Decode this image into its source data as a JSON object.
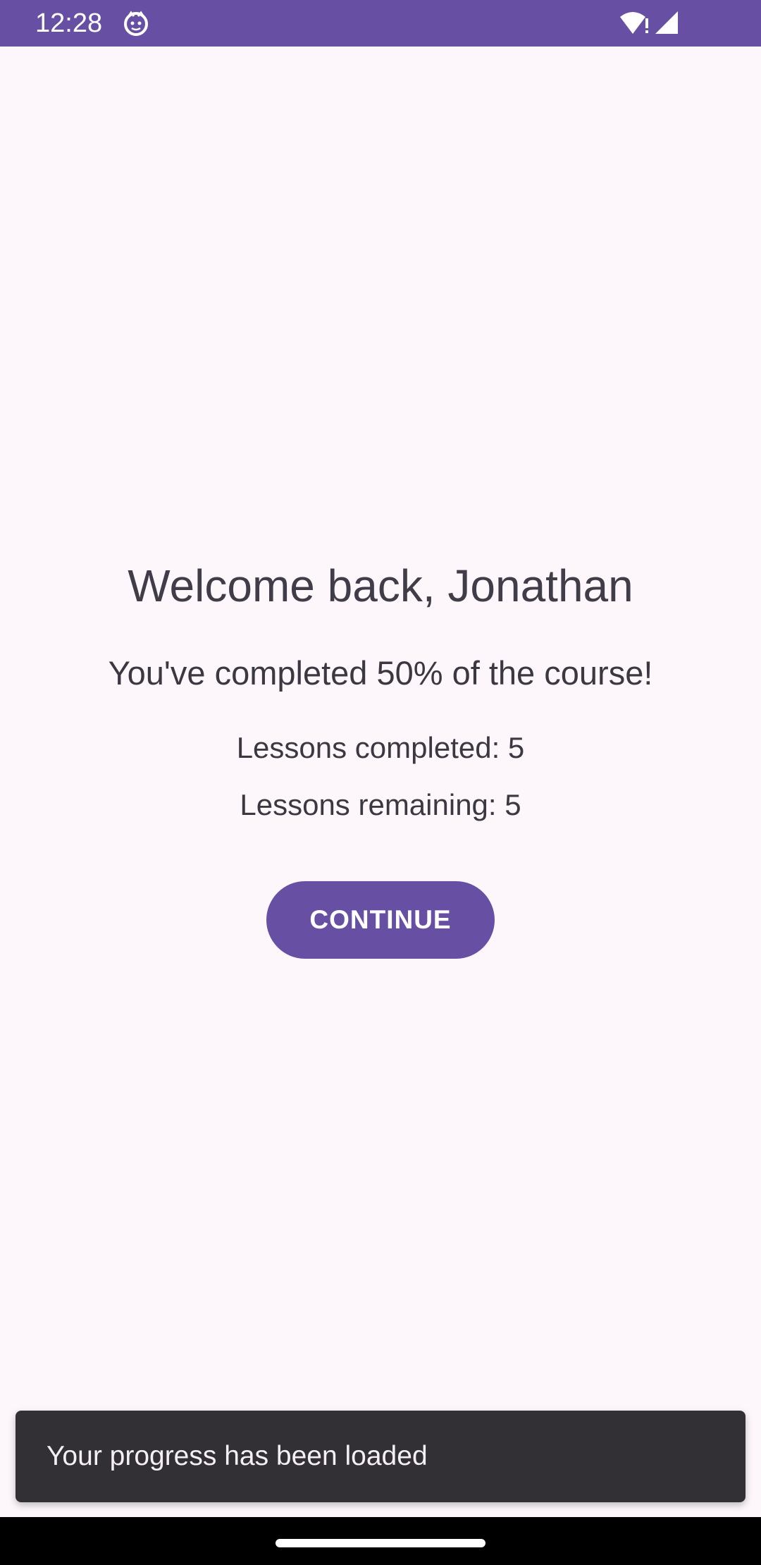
{
  "status_bar": {
    "time": "12:28",
    "app_icon": "cat-face-icon",
    "wifi_icon": "wifi-alert-icon",
    "signal_icon": "cell-signal-icon",
    "color": "#6750a4"
  },
  "main": {
    "welcome": "Welcome back, Jonathan",
    "progress_message": "You've completed 50% of the course!",
    "lessons_completed": "Lessons completed: 5",
    "lessons_remaining": "Lessons remaining: 5",
    "continue_label": "CONTINUE"
  },
  "snackbar": {
    "message": "Your progress has been loaded"
  },
  "nav_bar": {
    "home_indicator_icon": "home-indicator-icon"
  },
  "colors": {
    "accent": "#6750a4",
    "background": "#fdf7fc",
    "snackbar": "#322f35"
  }
}
